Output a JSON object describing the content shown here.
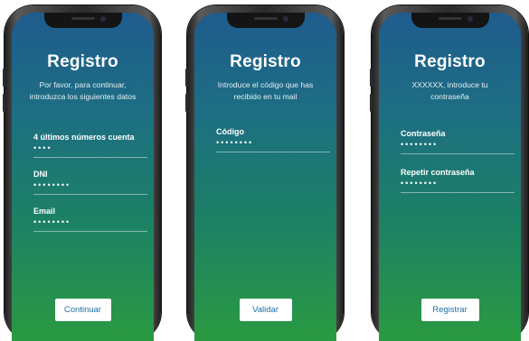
{
  "screens": [
    {
      "title": "Registro",
      "subtitle_lines": [
        "Por favor, para continuar,",
        "introduzca los siguientes datos"
      ],
      "fields": [
        {
          "label": "4 últimos números cuenta",
          "value": "••••"
        },
        {
          "label": "DNI",
          "value": "••••••••"
        },
        {
          "label": "Email",
          "value": "••••••••"
        }
      ],
      "button_label": "Continuar"
    },
    {
      "title": "Registro",
      "subtitle_lines": [
        "Introduce el código que has",
        "recibido en tu mail"
      ],
      "fields": [
        {
          "label": "Código",
          "value": "••••••••"
        }
      ],
      "button_label": "Validar"
    },
    {
      "title": "Registro",
      "subtitle_lines": [
        "XXXXXX, introduce tu",
        "contraseña"
      ],
      "fields": [
        {
          "label": "Contraseña",
          "value": "••••••••"
        },
        {
          "label": "Repetir contraseña",
          "value": "••••••••"
        }
      ],
      "button_label": "Registrar"
    }
  ],
  "colors": {
    "gradient_top": "#1f5c8e",
    "gradient_bottom": "#2a9a42",
    "button_text": "#1f6fa6"
  }
}
